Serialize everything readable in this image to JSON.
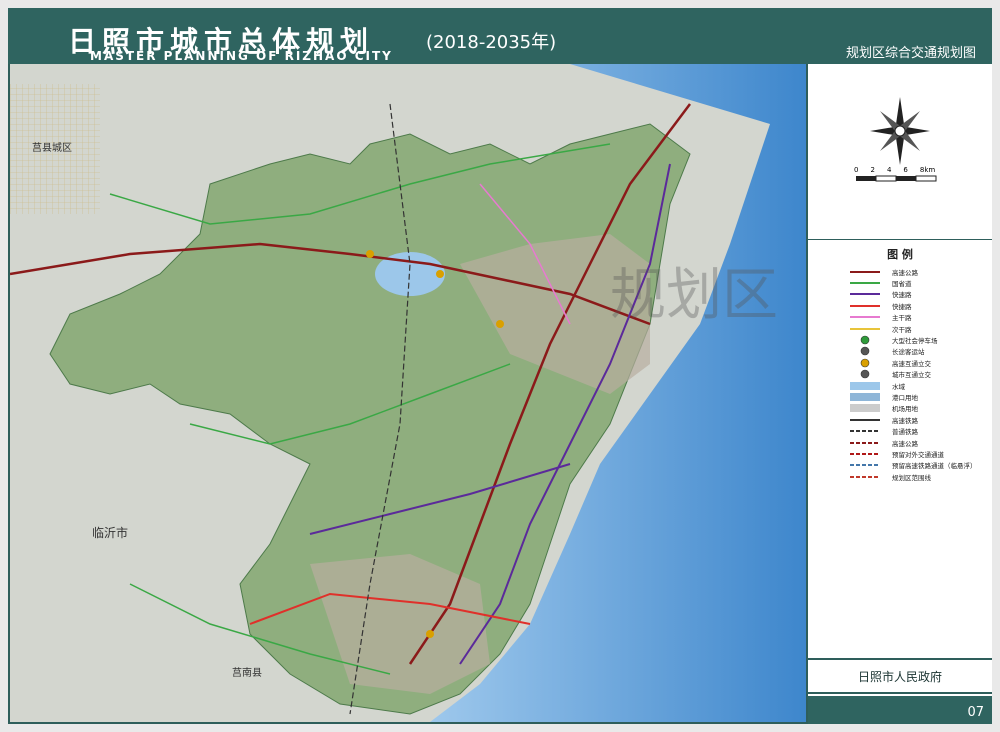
{
  "header": {
    "title": "日照市城市总体规划",
    "years": "(2018-2035年)",
    "subtitle": "MASTER PLANNING OF RIZHAO CITY",
    "map_title": "规划区综合交通规划图"
  },
  "map": {
    "labels": {
      "juxian": "莒县城区",
      "linyi": "临沂市",
      "junan": "莒南县"
    },
    "big_watermark": "规划区"
  },
  "scale": {
    "ticks": [
      "0",
      "2",
      "4",
      "6",
      "8km"
    ]
  },
  "legend": {
    "title": "图  例",
    "items": [
      {
        "label": "高速公路",
        "icon": "line-expressway",
        "color": "#8b1a1a"
      },
      {
        "label": "国省道",
        "icon": "line-national-road",
        "color": "#3aa845"
      },
      {
        "label": "快速路",
        "icon": "line-fast-road",
        "color": "#5b2a9a"
      },
      {
        "label": "快捷路",
        "icon": "line-quick-road",
        "color": "#e0302a"
      },
      {
        "label": "主干路",
        "icon": "line-main-road",
        "color": "#e77ad0"
      },
      {
        "label": "次干路",
        "icon": "line-secondary-road",
        "color": "#e8c43a"
      },
      {
        "label": "大型社会停车场",
        "icon": "parking-icon",
        "color": "#2f9b3a"
      },
      {
        "label": "长途客运站",
        "icon": "bus-station-icon",
        "color": "#555555"
      },
      {
        "label": "高速互通立交",
        "icon": "interchange-icon",
        "color": "#d9a000"
      },
      {
        "label": "城市互通立交",
        "icon": "city-interchange-icon",
        "color": "#555555"
      },
      {
        "label": "水域",
        "icon": "water-swatch",
        "color": "#9cc7ea"
      },
      {
        "label": "港口用地",
        "icon": "port-icon",
        "color": "#8fb6d8"
      },
      {
        "label": "机场用地",
        "icon": "airport-icon",
        "color": "#cccccc"
      },
      {
        "label": "高速铁路",
        "icon": "line-high-speed-rail",
        "color": "#333333"
      },
      {
        "label": "普通铁路",
        "icon": "line-railway",
        "color": "#333333"
      },
      {
        "label": "高速公路",
        "icon": "line-expressway-dashed",
        "color": "#8b1a1a"
      },
      {
        "label": "预留对外交通通道",
        "icon": "line-reserved-channel",
        "color": "#b01818"
      },
      {
        "label": "预留高速铁路通道（临悬浮）",
        "icon": "line-reserved-rail",
        "color": "#4477aa"
      },
      {
        "label": "规划区范围线",
        "icon": "line-planning-boundary",
        "color": "#c0392b"
      }
    ]
  },
  "footer": {
    "government": "日照市人民政府",
    "page": "07"
  },
  "colors": {
    "header_bg": "#2f6460",
    "land_green": "#8fae7e",
    "sea": "#6fa8dc"
  }
}
